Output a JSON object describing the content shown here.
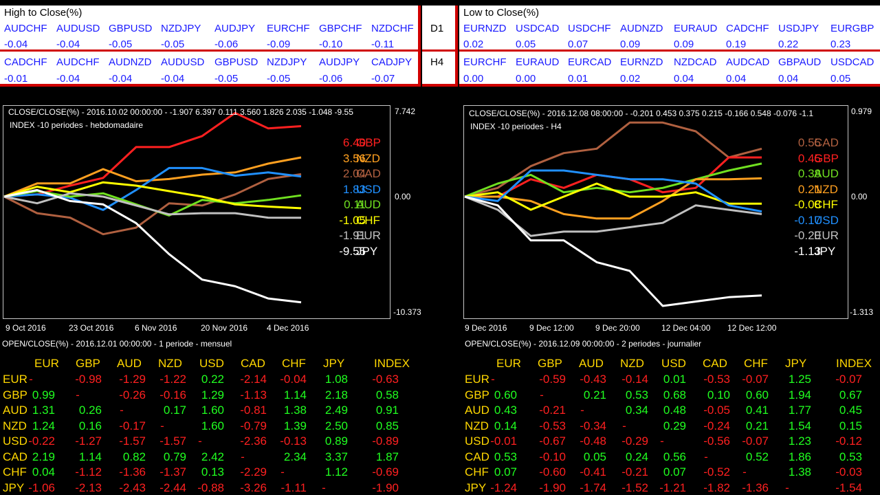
{
  "top": {
    "left_title": "High to Close(%)",
    "right_title": "Low to Close(%)",
    "tf1": "D1",
    "tf2": "H4",
    "hc_d1": [
      [
        "AUDCHF",
        "-0.04"
      ],
      [
        "AUDUSD",
        "-0.04"
      ],
      [
        "GBPUSD",
        "-0.05"
      ],
      [
        "NZDJPY",
        "-0.05"
      ],
      [
        "AUDJPY",
        "-0.06"
      ],
      [
        "EURCHF",
        "-0.09"
      ],
      [
        "GBPCHF",
        "-0.10"
      ],
      [
        "NZDCHF",
        "-0.11"
      ]
    ],
    "hc_h4": [
      [
        "CADCHF",
        "-0.01"
      ],
      [
        "AUDCHF",
        "-0.04"
      ],
      [
        "AUDNZD",
        "-0.04"
      ],
      [
        "AUDUSD",
        "-0.04"
      ],
      [
        "GBPUSD",
        "-0.05"
      ],
      [
        "NZDJPY",
        "-0.05"
      ],
      [
        "AUDJPY",
        "-0.06"
      ],
      [
        "CADJPY",
        "-0.07"
      ]
    ],
    "lc_d1": [
      [
        "EURNZD",
        "0.02"
      ],
      [
        "USDCAD",
        "0.05"
      ],
      [
        "USDCHF",
        "0.07"
      ],
      [
        "AUDNZD",
        "0.09"
      ],
      [
        "EURAUD",
        "0.09"
      ],
      [
        "CADCHF",
        "0.19"
      ],
      [
        "USDJPY",
        "0.22"
      ],
      [
        "EURGBP",
        "0.23"
      ]
    ],
    "lc_h4": [
      [
        "EURCHF",
        "0.00"
      ],
      [
        "EURAUD",
        "0.00"
      ],
      [
        "EURCAD",
        "0.01"
      ],
      [
        "EURNZD",
        "0.02"
      ],
      [
        "NZDCAD",
        "0.04"
      ],
      [
        "AUDCAD",
        "0.04"
      ],
      [
        "GBPAUD",
        "0.04"
      ],
      [
        "USDCAD",
        "0.05"
      ]
    ]
  },
  "colors": {
    "GBP": "#ff2020",
    "NZD": "#ffa020",
    "CAD": "#b06040",
    "USD": "#2090ff",
    "AUD": "#70e020",
    "CHF": "#ffff00",
    "EUR": "#c0c0c0",
    "JPY": "#ffffff",
    "positive": "#20ff20",
    "negative": "#ff2020",
    "neutral": "#ffd700"
  },
  "charts": [
    {
      "header": "CLOSE/CLOSE(%) - 2016.10.02 00:00:00 -   -1.907  6.397  0.111  3.560  1.826  2.035  -1.048  -9.55",
      "subtitle": "INDEX -10 periodes - hebdomadaire",
      "scale_top": "7.742",
      "scale_zero": "0.00",
      "scale_bottom": "-10.373",
      "date_labels": [
        "9 Oct 2016",
        "23 Oct 2016",
        "6 Nov 2016",
        "20 Nov 2016",
        "4 Dec 2016"
      ],
      "legend": [
        {
          "value": "6.40",
          "ccy": "GBP"
        },
        {
          "value": "3.56",
          "ccy": "NZD"
        },
        {
          "value": "2.04",
          "ccy": "CAD"
        },
        {
          "value": "1.83",
          "ccy": "USD"
        },
        {
          "value": "0.11",
          "ccy": "AUD"
        },
        {
          "value": "-1.05",
          "ccy": "CHF"
        },
        {
          "value": "-1.91",
          "ccy": "EUR"
        },
        {
          "value": "-9.55",
          "ccy": "JPY"
        }
      ],
      "ymin": -10.373,
      "ymax": 7.742,
      "series": [
        {
          "name": "GBP",
          "values": [
            0,
            0.2,
            1.0,
            1.7,
            4.5,
            4.5,
            5.5,
            7.6,
            6.2,
            6.4
          ]
        },
        {
          "name": "NZD",
          "values": [
            0,
            1.2,
            1.2,
            2.5,
            1.4,
            1.6,
            2.0,
            2.2,
            3.0,
            3.56
          ]
        },
        {
          "name": "CAD",
          "values": [
            0,
            -1.5,
            -1.9,
            -3.4,
            -2.8,
            -0.6,
            -0.8,
            0.2,
            1.6,
            2.04
          ]
        },
        {
          "name": "USD",
          "values": [
            0,
            0.2,
            -0.1,
            -1.2,
            0.6,
            2.6,
            2.6,
            1.9,
            2.2,
            1.83
          ]
        },
        {
          "name": "AUD",
          "values": [
            0,
            0.5,
            0.0,
            0.3,
            -0.7,
            -1.7,
            -0.3,
            -0.6,
            -0.3,
            0.11
          ]
        },
        {
          "name": "CHF",
          "values": [
            0,
            0.9,
            0.4,
            1.3,
            1.0,
            0.5,
            0.0,
            -0.7,
            -0.9,
            -1.05
          ]
        },
        {
          "name": "EUR",
          "values": [
            0,
            -0.6,
            0.3,
            0.0,
            -0.8,
            -1.6,
            -1.5,
            -1.5,
            -1.9,
            -1.91
          ]
        },
        {
          "name": "JPY",
          "values": [
            0,
            0.6,
            -0.4,
            -0.7,
            -2.4,
            -5.2,
            -7.5,
            -8.1,
            -9.2,
            -9.55
          ]
        }
      ]
    },
    {
      "header": "CLOSE/CLOSE(%) - 2016.12.08 08:00:00 -   -0.201  0.453  0.375  0.215  -0.166  0.548  -0.076  -1.1",
      "subtitle": "INDEX -10 periodes - H4",
      "scale_top": "0.979",
      "scale_zero": "0.00",
      "scale_bottom": "-1.313",
      "date_labels": [
        "9 Dec 2016",
        "9 Dec 12:00",
        "9 Dec 20:00",
        "12 Dec 04:00",
        "12 Dec 12:00"
      ],
      "legend": [
        {
          "value": "0.55",
          "ccy": "CAD"
        },
        {
          "value": "0.45",
          "ccy": "GBP"
        },
        {
          "value": "0.38",
          "ccy": "AUD"
        },
        {
          "value": "0.21",
          "ccy": "NZD"
        },
        {
          "value": "-0.08",
          "ccy": "CHF"
        },
        {
          "value": "-0.17",
          "ccy": "USD"
        },
        {
          "value": "-0.20",
          "ccy": "EUR"
        },
        {
          "value": "-1.13",
          "ccy": "JPY"
        }
      ],
      "ymin": -1.313,
      "ymax": 0.979,
      "series": [
        {
          "name": "CAD",
          "values": [
            0,
            0.1,
            0.35,
            0.5,
            0.55,
            0.85,
            0.85,
            0.75,
            0.45,
            0.55
          ]
        },
        {
          "name": "GBP",
          "values": [
            0,
            0.0,
            0.2,
            0.1,
            0.25,
            0.2,
            0.05,
            0.1,
            0.45,
            0.45
          ]
        },
        {
          "name": "AUD",
          "values": [
            0,
            0.15,
            0.25,
            0.05,
            0.1,
            0.05,
            0.1,
            0.2,
            0.3,
            0.38
          ]
        },
        {
          "name": "NZD",
          "values": [
            0,
            0.0,
            -0.05,
            -0.2,
            -0.25,
            -0.25,
            -0.05,
            0.2,
            0.2,
            0.21
          ]
        },
        {
          "name": "CHF",
          "values": [
            0,
            0.05,
            -0.15,
            0.0,
            0.15,
            0.0,
            0.0,
            0.05,
            -0.08,
            -0.08
          ]
        },
        {
          "name": "USD",
          "values": [
            0,
            -0.05,
            0.3,
            0.3,
            0.25,
            0.2,
            0.2,
            0.15,
            -0.1,
            -0.17
          ]
        },
        {
          "name": "EUR",
          "values": [
            0,
            -0.15,
            -0.45,
            -0.4,
            -0.4,
            -0.35,
            -0.3,
            -0.1,
            -0.15,
            -0.2
          ]
        },
        {
          "name": "JPY",
          "values": [
            0,
            -0.1,
            -0.5,
            -0.5,
            -0.75,
            -0.85,
            -1.25,
            -1.2,
            -1.15,
            -1.13
          ]
        }
      ]
    }
  ],
  "tables": [
    {
      "caption": "OPEN/CLOSE(%) - 2016.12.01 00:00:00 - 1 periode - mensuel",
      "cols": [
        "EUR",
        "GBP",
        "AUD",
        "NZD",
        "USD",
        "CAD",
        "CHF",
        "JPY",
        "INDEX"
      ],
      "rows": [
        {
          "label": "EUR",
          "cells": [
            "-",
            "-0.98",
            "-1.29",
            "-1.22",
            "0.22",
            "-2.14",
            "-0.04",
            "1.08",
            "-0.63"
          ]
        },
        {
          "label": "GBP",
          "cells": [
            "0.99",
            "-",
            "-0.26",
            "-0.16",
            "1.29",
            "-1.13",
            "1.14",
            "2.18",
            "0.58"
          ]
        },
        {
          "label": "AUD",
          "cells": [
            "1.31",
            "0.26",
            "-",
            "0.17",
            "1.60",
            "-0.81",
            "1.38",
            "2.49",
            "0.91"
          ]
        },
        {
          "label": "NZD",
          "cells": [
            "1.24",
            "0.16",
            "-0.17",
            "-",
            "1.60",
            "-0.79",
            "1.39",
            "2.50",
            "0.85"
          ]
        },
        {
          "label": "USD",
          "cells": [
            "-0.22",
            "-1.27",
            "-1.57",
            "-1.57",
            "-",
            "-2.36",
            "-0.13",
            "0.89",
            "-0.89"
          ]
        },
        {
          "label": "CAD",
          "cells": [
            "2.19",
            "1.14",
            "0.82",
            "0.79",
            "2.42",
            "-",
            "2.34",
            "3.37",
            "1.87"
          ]
        },
        {
          "label": "CHF",
          "cells": [
            "0.04",
            "-1.12",
            "-1.36",
            "-1.37",
            "0.13",
            "-2.29",
            "-",
            "1.12",
            "-0.69"
          ]
        },
        {
          "label": "JPY",
          "cells": [
            "-1.06",
            "-2.13",
            "-2.43",
            "-2.44",
            "-0.88",
            "-3.26",
            "-1.11",
            "-",
            "-1.90"
          ]
        }
      ]
    },
    {
      "caption": "OPEN/CLOSE(%) - 2016.12.09 00:00:00 - 2 periodes - journalier",
      "cols": [
        "EUR",
        "GBP",
        "AUD",
        "NZD",
        "USD",
        "CAD",
        "CHF",
        "JPY",
        "INDEX"
      ],
      "rows": [
        {
          "label": "EUR",
          "cells": [
            "-",
            "-0.59",
            "-0.43",
            "-0.14",
            "0.01",
            "-0.53",
            "-0.07",
            "1.25",
            "-0.07"
          ]
        },
        {
          "label": "GBP",
          "cells": [
            "0.60",
            "-",
            "0.21",
            "0.53",
            "0.68",
            "0.10",
            "0.60",
            "1.94",
            "0.67"
          ]
        },
        {
          "label": "AUD",
          "cells": [
            "0.43",
            "-0.21",
            "-",
            "0.34",
            "0.48",
            "-0.05",
            "0.41",
            "1.77",
            "0.45"
          ]
        },
        {
          "label": "NZD",
          "cells": [
            "0.14",
            "-0.53",
            "-0.34",
            "-",
            "0.29",
            "-0.24",
            "0.21",
            "1.54",
            "0.15"
          ]
        },
        {
          "label": "USD",
          "cells": [
            "-0.01",
            "-0.67",
            "-0.48",
            "-0.29",
            "-",
            "-0.56",
            "-0.07",
            "1.23",
            "-0.12"
          ]
        },
        {
          "label": "CAD",
          "cells": [
            "0.53",
            "-0.10",
            "0.05",
            "0.24",
            "0.56",
            "-",
            "0.52",
            "1.86",
            "0.53"
          ]
        },
        {
          "label": "CHF",
          "cells": [
            "0.07",
            "-0.60",
            "-0.41",
            "-0.21",
            "0.07",
            "-0.52",
            "-",
            "1.38",
            "-0.03"
          ]
        },
        {
          "label": "JPY",
          "cells": [
            "-1.24",
            "-1.90",
            "-1.74",
            "-1.52",
            "-1.21",
            "-1.82",
            "-1.36",
            "-",
            "-1.54"
          ]
        }
      ]
    }
  ]
}
